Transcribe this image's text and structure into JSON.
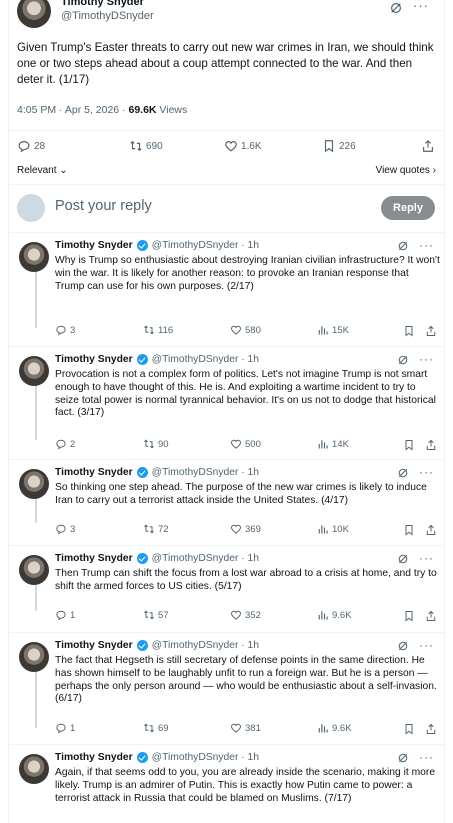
{
  "main_tweet": {
    "name": "Timothy Snyder",
    "handle": "@TimothyDSnyder",
    "text": "Given Trump's Easter threats to carry out new war crimes in Iran, we should think one or two steps ahead about a coup attempt connected to the war. And then deter it. (1/17)",
    "time": "4:05 PM · Apr 5, 2026 · ",
    "views": "69.6K",
    "views_label": " Views",
    "replies": "28",
    "reposts": "690",
    "likes": "1.6K",
    "bookmarks": "226"
  },
  "sort_label": "Relevant",
  "view_quotes": "View quotes",
  "reply_placeholder": "Post your reply",
  "reply_button": "Reply",
  "thread": [
    {
      "name": "Timothy Snyder",
      "handle": "@TimothyDSnyder · 1h",
      "text": "Why is Trump so enthusiastic about destroying Iranian civilian infrastructure? It won't win the war. It is likely for another reason: to provoke an Iranian response that Trump can use for his own purposes. (2/17)",
      "replies": "3",
      "reposts": "116",
      "likes": "580",
      "views": "15K"
    },
    {
      "name": "Timothy Snyder",
      "handle": "@TimothyDSnyder · 1h",
      "text": "Provocation is not a complex form of politics. Let's not imagine Trump is not smart enough to have thought of this. He is. And exploiting a wartime incident to try to seize total power is normal tyrannical behavior. It's on us not to dodge that historical fact. (3/17)",
      "replies": "2",
      "reposts": "90",
      "likes": "500",
      "views": "14K"
    },
    {
      "name": "Timothy Snyder",
      "handle": "@TimothyDSnyder · 1h",
      "text": "So thinking one step ahead. The purpose of the new war crimes is likely to induce Iran to carry out a terrorist attack inside the United States. (4/17)",
      "replies": "3",
      "reposts": "72",
      "likes": "369",
      "views": "10K"
    },
    {
      "name": "Timothy Snyder",
      "handle": "@TimothyDSnyder · 1h",
      "text": "Then Trump can shift the focus from a lost war abroad to a crisis at home, and try to shift the armed forces to US cities. (5/17)",
      "replies": "1",
      "reposts": "57",
      "likes": "352",
      "views": "9.6K"
    },
    {
      "name": "Timothy Snyder",
      "handle": "@TimothyDSnyder · 1h",
      "text": "The fact that Hegseth is still secretary of defense points in the same direction. He has shown himself to be laughably unfit to run a foreign war. But he is a person — perhaps the only person around — who would be enthusiastic about a self-invasion. (6/17)",
      "replies": "1",
      "reposts": "69",
      "likes": "381",
      "views": "9.6K"
    },
    {
      "name": "Timothy Snyder",
      "handle": "@TimothyDSnyder · 1h",
      "text": "Again, if that seems odd to you, you are already inside the scenario, making it more likely. Trump is an admirer of Putin. This is exactly how Putin came to power: a terrorist attack in Russia that could be blamed on Muslims. (7/17)"
    }
  ]
}
